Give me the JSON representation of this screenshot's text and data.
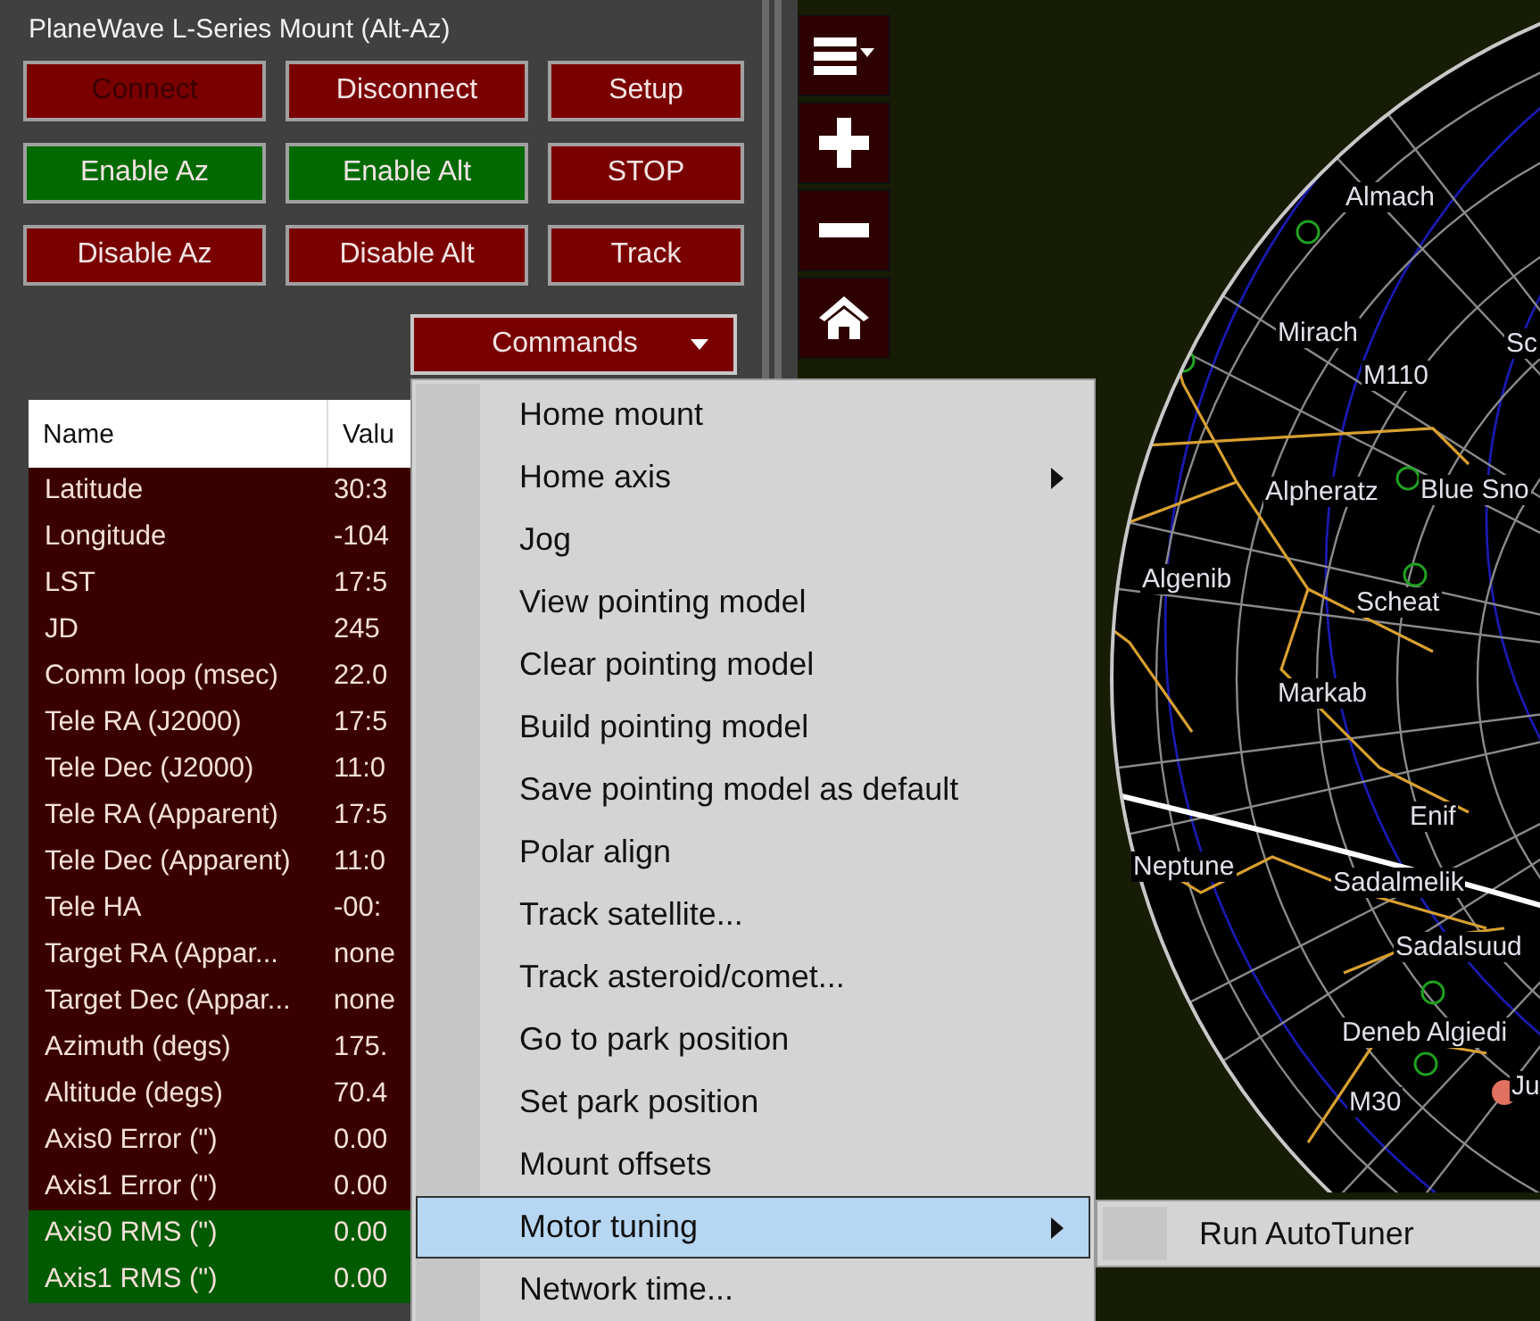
{
  "panel": {
    "title": "PlaneWave L-Series Mount (Alt-Az)",
    "buttons": [
      {
        "label": "Connect",
        "disabled": true,
        "highlighted": false
      },
      {
        "label": "Disconnect",
        "disabled": false,
        "highlighted": false
      },
      {
        "label": "Setup",
        "disabled": false,
        "highlighted": false
      },
      {
        "label": "Enable Az",
        "disabled": false,
        "highlighted": true
      },
      {
        "label": "Enable Alt",
        "disabled": false,
        "highlighted": true
      },
      {
        "label": "STOP",
        "disabled": false,
        "highlighted": false
      },
      {
        "label": "Disable Az",
        "disabled": false,
        "highlighted": false
      },
      {
        "label": "Disable Alt",
        "disabled": false,
        "highlighted": false
      },
      {
        "label": "Track",
        "disabled": false,
        "highlighted": false
      }
    ],
    "commands_button": {
      "label": "Commands",
      "expanded": true
    }
  },
  "table": {
    "columns": [
      "Name",
      "Valu"
    ],
    "rows": [
      {
        "name": "Latitude",
        "value": "30:3",
        "highlighted": false
      },
      {
        "name": "Longitude",
        "value": "-104",
        "highlighted": false
      },
      {
        "name": "LST",
        "value": "17:5",
        "highlighted": false
      },
      {
        "name": "JD",
        "value": "245",
        "highlighted": false
      },
      {
        "name": "Comm loop (msec)",
        "value": "22.0",
        "highlighted": false
      },
      {
        "name": "Tele RA (J2000)",
        "value": "17:5",
        "highlighted": false
      },
      {
        "name": "Tele Dec (J2000)",
        "value": "11:0",
        "highlighted": false
      },
      {
        "name": "Tele RA (Apparent)",
        "value": "17:5",
        "highlighted": false
      },
      {
        "name": "Tele Dec (Apparent)",
        "value": "11:0",
        "highlighted": false
      },
      {
        "name": "Tele HA",
        "value": "-00:",
        "highlighted": false
      },
      {
        "name": "Target RA (Appar...",
        "value": "none",
        "highlighted": false
      },
      {
        "name": "Target Dec (Appar...",
        "value": "none",
        "highlighted": false
      },
      {
        "name": "Azimuth (degs)",
        "value": "175.",
        "highlighted": false
      },
      {
        "name": "Altitude (degs)",
        "value": "70.4",
        "highlighted": false
      },
      {
        "name": "Axis0 Error (\")",
        "value": "0.00",
        "highlighted": false
      },
      {
        "name": "Axis1 Error (\")",
        "value": "0.00",
        "highlighted": false
      },
      {
        "name": "Axis0 RMS (\")",
        "value": "0.00",
        "highlighted": true
      },
      {
        "name": "Axis1 RMS (\")",
        "value": "0.00",
        "highlighted": true
      }
    ]
  },
  "commands_menu": {
    "items": [
      {
        "label": "Home mount",
        "has_submenu": false,
        "selected": false
      },
      {
        "label": "Home axis",
        "has_submenu": true,
        "selected": false
      },
      {
        "label": "Jog",
        "has_submenu": false,
        "selected": false
      },
      {
        "label": "View pointing model",
        "has_submenu": false,
        "selected": false
      },
      {
        "label": "Clear pointing model",
        "has_submenu": false,
        "selected": false
      },
      {
        "label": "Build pointing model",
        "has_submenu": false,
        "selected": false
      },
      {
        "label": "Save pointing model as default",
        "has_submenu": false,
        "selected": false
      },
      {
        "label": "Polar align",
        "has_submenu": false,
        "selected": false
      },
      {
        "label": "Track satellite...",
        "has_submenu": false,
        "selected": false
      },
      {
        "label": "Track asteroid/comet...",
        "has_submenu": false,
        "selected": false
      },
      {
        "label": "Go to park position",
        "has_submenu": false,
        "selected": false
      },
      {
        "label": "Set park position",
        "has_submenu": false,
        "selected": false
      },
      {
        "label": "Mount offsets",
        "has_submenu": false,
        "selected": false
      },
      {
        "label": "Motor tuning",
        "has_submenu": true,
        "selected": true
      },
      {
        "label": "Network time...",
        "has_submenu": false,
        "selected": false
      }
    ],
    "submenu": {
      "items": [
        {
          "label": "Run AutoTuner",
          "selected": false
        }
      ]
    }
  },
  "sky_map": {
    "labels": [
      "Almach",
      "Mirach",
      "M110",
      "Sc",
      "Alpheratz",
      "Blue Sno",
      "Algenib",
      "Scheat",
      "Markab",
      "Enif",
      "Neptune",
      "Sadalmelik",
      "Sadalsuud",
      "Deneb Algiedi",
      "M30",
      "Ju"
    ]
  }
}
